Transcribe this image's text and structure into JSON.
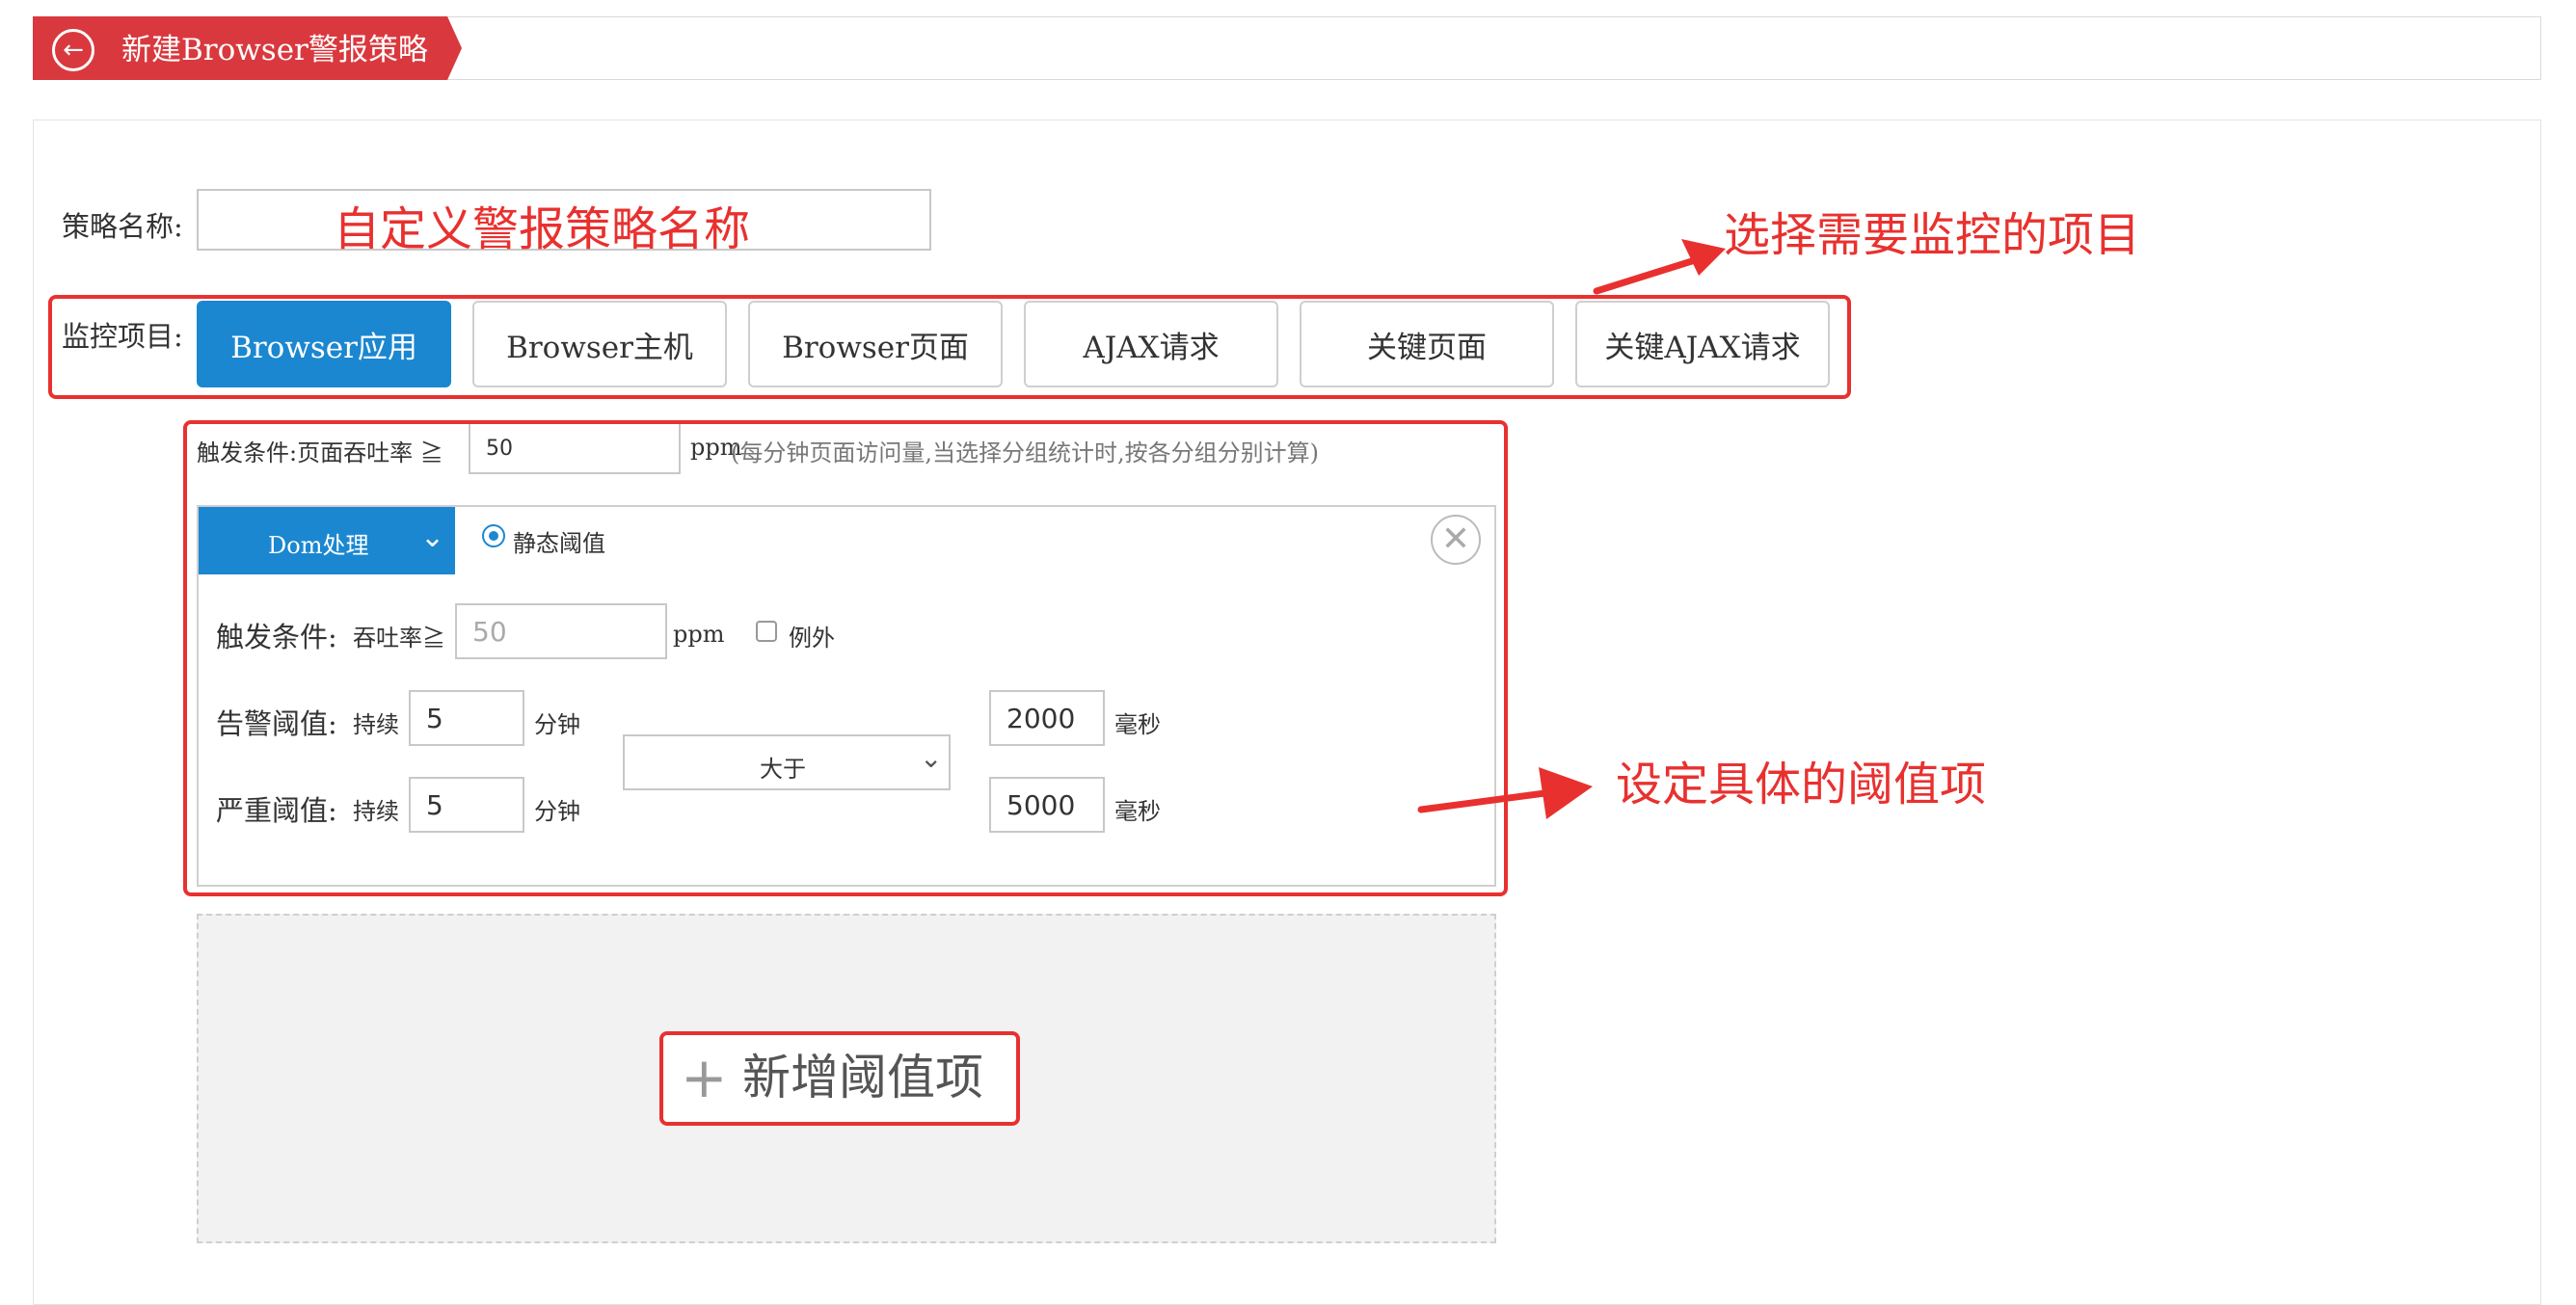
{
  "header": {
    "title": "新建Browser警报策略",
    "back_icon": "←"
  },
  "form": {
    "policy_name_label": "策略名称:",
    "policy_name_value": "",
    "monitor_label": "监控项目:",
    "tabs": [
      {
        "label": "Browser应用",
        "active": true
      },
      {
        "label": "Browser主机",
        "active": false
      },
      {
        "label": "Browser页面",
        "active": false
      },
      {
        "label": "AJAX请求",
        "active": false
      },
      {
        "label": "关键页面",
        "active": false
      },
      {
        "label": "关键AJAX请求",
        "active": false
      }
    ]
  },
  "trigger": {
    "label": "触发条件:页面吞吐率 ≧",
    "value": "50",
    "unit": "ppm",
    "note": "(每分钟页面访问量,当选择分组统计时,按各分组分别计算)"
  },
  "threshold_card": {
    "metric_select": "Dom处理",
    "chevron_icon": "⌄",
    "threshold_type": "静态阈值",
    "close_icon": "✕",
    "trigger_label": "触发条件:",
    "throughput_label": "吞吐率≧",
    "throughput_placeholder": "50",
    "throughput_unit": "ppm",
    "exception_label": "例外",
    "warning_label": "告警阈值:",
    "warning_duration_label": "持续",
    "warning_duration": "5",
    "warning_duration_unit": "分钟",
    "critical_label": "严重阈值:",
    "critical_duration_label": "持续",
    "critical_duration": "5",
    "critical_duration_unit": "分钟",
    "comparator": "大于",
    "warning_value": "2000",
    "warning_value_unit": "毫秒",
    "critical_value": "5000",
    "critical_value_unit": "毫秒"
  },
  "add_threshold": {
    "plus_icon": "+",
    "label": "新增阈值项"
  },
  "annotations": {
    "policy_name_hint": "自定义警报策略名称",
    "monitor_hint": "选择需要监控的项目",
    "threshold_hint": "设定具体的阈值项"
  },
  "colors": {
    "accent": "#1b87d0",
    "brand_red": "#d9393e",
    "annotation_red": "#e8312f"
  }
}
